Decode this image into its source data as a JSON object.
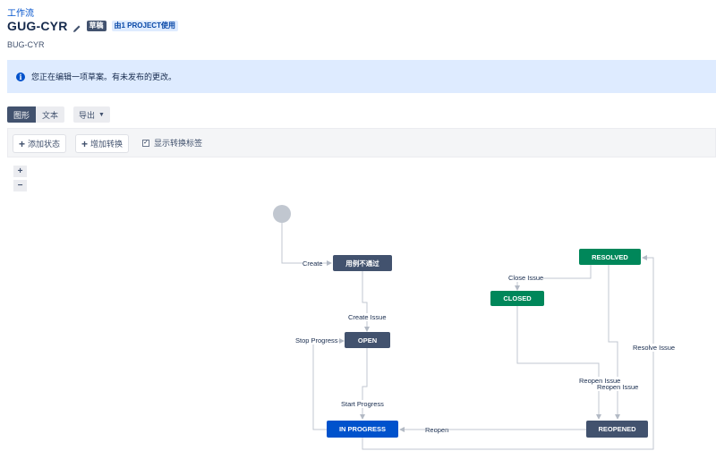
{
  "breadcrumb": "工作流",
  "title": "GUG-CYR",
  "draft_label": "草稿",
  "project_label": "由1 PROJECT使用",
  "subtitle": "BUG-CYR",
  "banner": {
    "icon": "info-icon",
    "text": "您正在编辑一项草案。有未发布的更改。"
  },
  "view_tabs": [
    "图形",
    "文本"
  ],
  "export_label": "导出",
  "toolbar": {
    "add_status": "添加状态",
    "add_transition": "增加转换",
    "show_labels": "显示转换标签"
  },
  "zoom": {
    "in": "+",
    "out": "−"
  },
  "colors": {
    "dark_status": "#42526e",
    "done_status": "#00875a",
    "in_progress": "#0052cc",
    "start_circle": "#c1c7d0"
  },
  "diagram": {
    "statuses": {
      "s1": "用例不通过",
      "open": "OPEN",
      "in_progress": "IN PROGRESS",
      "reopened": "REOPENED",
      "resolved": "RESOLVED",
      "closed": "CLOSED"
    },
    "transitions": {
      "create": "Create",
      "create_issue": "Create Issue",
      "stop_progress": "Stop Progress",
      "start_progress": "Start Progress",
      "reopen": "Reopen",
      "close_issue": "Close Issue",
      "resolve_issue": "Resolve Issue",
      "reopen_issue_1": "Reopen Issue",
      "reopen_issue_2": "Reopen Issue"
    }
  }
}
